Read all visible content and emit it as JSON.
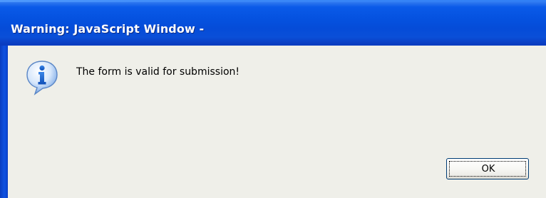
{
  "window": {
    "title": "Warning: JavaScript Window -"
  },
  "dialog": {
    "icon": "info-icon",
    "message": "The form is valid for submission!",
    "ok_label": "OK"
  },
  "colors": {
    "titlebar": "#0552e0",
    "client": "#efefe9",
    "icon_blue": "#1f6fd6"
  }
}
